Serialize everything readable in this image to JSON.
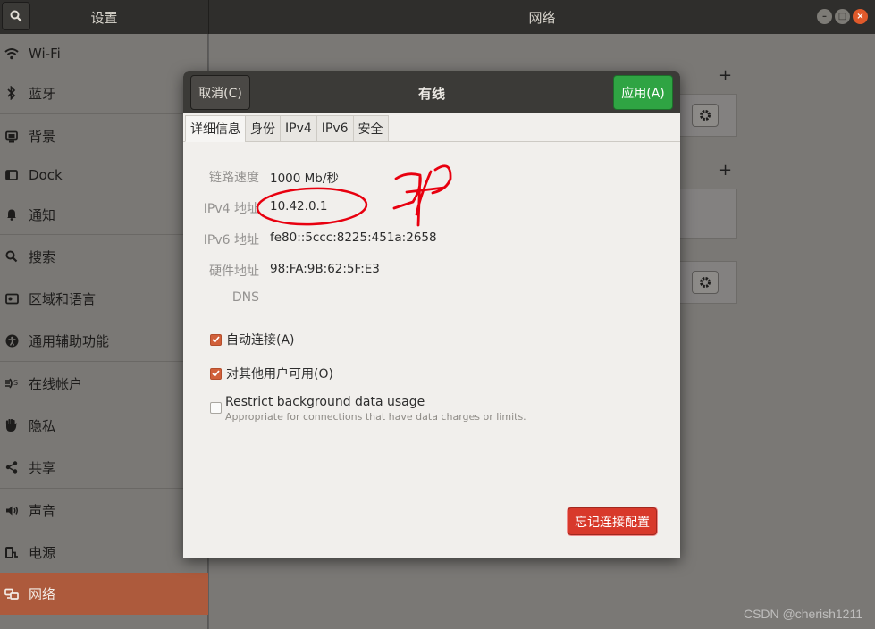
{
  "header": {
    "left_title": "设置",
    "right_title": "网络"
  },
  "sidebar": {
    "items": [
      {
        "label": "Wi-Fi",
        "icon": "wifi-icon"
      },
      {
        "label": "蓝牙",
        "icon": "bluetooth-icon"
      },
      {
        "label": "背景",
        "icon": "background-icon"
      },
      {
        "label": "Dock",
        "icon": "dock-icon"
      },
      {
        "label": "通知",
        "icon": "bell-icon"
      },
      {
        "label": "搜索",
        "icon": "search-icon"
      },
      {
        "label": "区域和语言",
        "icon": "region-icon"
      },
      {
        "label": "通用辅助功能",
        "icon": "accessibility-icon"
      },
      {
        "label": "在线帐户",
        "icon": "online-accounts-icon"
      },
      {
        "label": "隐私",
        "icon": "privacy-hand-icon"
      },
      {
        "label": "共享",
        "icon": "share-icon"
      },
      {
        "label": "声音",
        "icon": "speaker-icon"
      },
      {
        "label": "电源",
        "icon": "power-icon"
      },
      {
        "label": "网络",
        "icon": "network-icon"
      }
    ],
    "active_index": 13
  },
  "dialog": {
    "title": "有线",
    "cancel_label": "取消(C)",
    "apply_label": "应用(A)",
    "tabs": [
      "详细信息",
      "身份",
      "IPv4",
      "IPv6",
      "安全"
    ],
    "active_tab": 0,
    "details": {
      "link_speed_key": "链路速度",
      "link_speed_val": "1000 Mb/秒",
      "ipv4_key": "IPv4 地址",
      "ipv4_val": "10.42.0.1",
      "ipv6_key": "IPv6 地址",
      "ipv6_val": "fe80::5ccc:8225:451a:2658",
      "hw_key": "硬件地址",
      "hw_val": "98:FA:9B:62:5F:E3",
      "dns_key": "DNS"
    },
    "auto_connect_label": "自动连接(A)",
    "auto_connect_checked": true,
    "other_users_label": "对其他用户可用(O)",
    "other_users_checked": true,
    "restrict_label": "Restrict background data usage",
    "restrict_sub": "Appropriate for connections that have data charges or limits.",
    "restrict_checked": false,
    "forget_label": "忘记连接配置"
  },
  "colors": {
    "accent_orange": "#ad5a3c",
    "apply_green": "#2fa443",
    "forget_red": "#d8392b",
    "annotation_red": "#e8000f"
  },
  "watermark": "CSDN @cherish1211"
}
